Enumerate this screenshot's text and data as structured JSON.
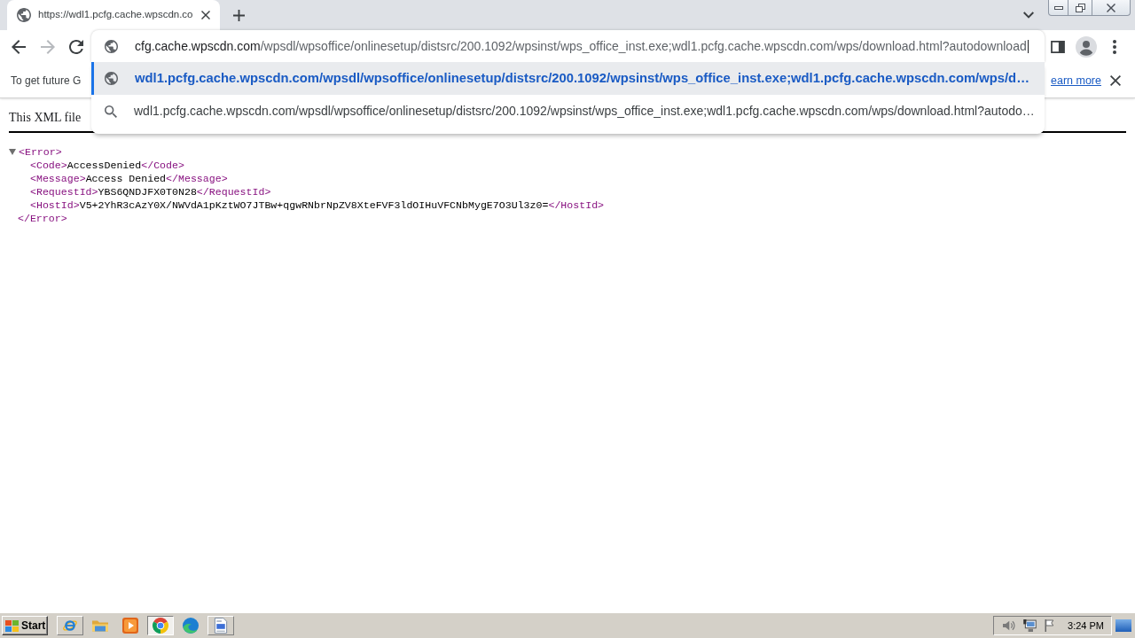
{
  "browser": {
    "tabs": [
      {
        "title": "https://wdl1.pcfg.cache.wpscdn.co",
        "selected": true
      }
    ],
    "nav_buttons": [
      {
        "kind": "back",
        "disabled": false
      },
      {
        "kind": "forward",
        "disabled": true
      },
      {
        "kind": "reload",
        "disabled": false
      }
    ],
    "omnibox": {
      "host": "cfg.cache.wpscdn.com",
      "path": "/wpsdl/wpsoffice/onlinesetup/distsrc/200.1092/wpsinst/wps_office_inst.exe;wdl1.pcfg.cache.wpscdn.com/wps/download.html?autodownload"
    },
    "suggestions": [
      {
        "kind": "url",
        "text": "wdl1.pcfg.cache.wpscdn.com/wpsdl/wpsoffice/onlinesetup/distsrc/200.1092/wpsinst/wps_office_inst.exe;wdl1.pcfg.cache.wpscdn.com/wps/d…",
        "selected": true
      },
      {
        "kind": "search",
        "text": "wdl1.pcfg.cache.wpscdn.com/wpsdl/wpsoffice/onlinesetup/distsrc/200.1092/wpsinst/wps_office_inst.exe;wdl1.pcfg.cache.wpscdn.com/wps/download.html?autodo…",
        "selected": false
      }
    ]
  },
  "info_bar": {
    "message": "To get future G",
    "link": "earn more"
  },
  "page": {
    "header": "This XML file",
    "xml": {
      "open_tag": "<Error>",
      "close_tag": "</Error>",
      "expanded": true,
      "children": [
        {
          "open_tag": "<Code>",
          "text": "AccessDenied",
          "close_tag": "</Code>"
        },
        {
          "open_tag": "<Message>",
          "text": "Access Denied",
          "close_tag": "</Message>"
        },
        {
          "open_tag": "<RequestId>",
          "text": "YBS6QNDJFX0T0N28",
          "close_tag": "</RequestId>"
        },
        {
          "open_tag": "<HostId>",
          "text": "V5+2YhR3cAzY0X/NWVdA1pKztWO7JTBw+qgwRNbrNpZV8XteFVF3ldOIHuVFCNbMygE7O3Ul3z0=",
          "close_tag": "</HostId>"
        }
      ]
    }
  },
  "taskbar": {
    "start": "Start",
    "items": [
      {
        "kind": "e-browser",
        "raised": true,
        "pressed": false
      },
      {
        "kind": "folder",
        "raised": false,
        "pressed": false
      },
      {
        "kind": "player",
        "raised": false,
        "pressed": false
      },
      {
        "kind": "round-browser",
        "raised": false,
        "pressed": true
      },
      {
        "kind": "swirl-browser",
        "raised": false,
        "pressed": false
      },
      {
        "kind": "document",
        "raised": true,
        "pressed": false
      }
    ],
    "clock": "3:24 PM"
  }
}
